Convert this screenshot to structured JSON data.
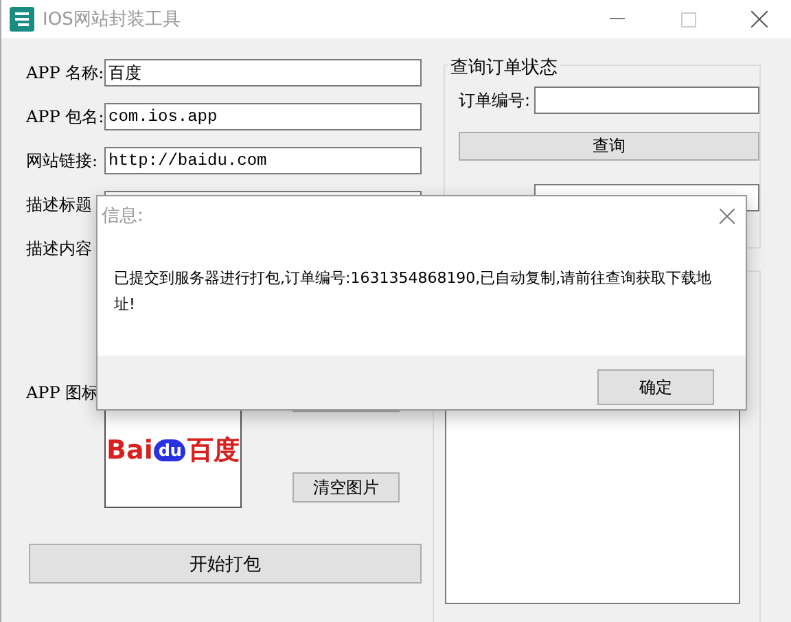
{
  "window": {
    "title": "IOS网站封装工具"
  },
  "form": {
    "fields": [
      {
        "label": "APP 名称:",
        "value": "百度"
      },
      {
        "label": "APP 包名:",
        "value": "com.ios.app"
      },
      {
        "label": "网站链接:",
        "value": "http://baidu.com"
      },
      {
        "label": "描述标题"
      }
    ],
    "description_label": "描述内容",
    "icon_label": "APP 图标",
    "icon": {
      "left": "Bai",
      "paw": "du",
      "right": "百度"
    },
    "clear_button": "清空图片",
    "pack_button": "开始打包"
  },
  "query": {
    "title": "查询订单状态",
    "order_label": "订单编号:",
    "query_button": "查询"
  },
  "dialog": {
    "title": "信息:",
    "message": "已提交到服务器进行打包,订单编号:1631354868190,已自动复制,请前往查询获取下载地址!",
    "ok_button": "确定"
  }
}
